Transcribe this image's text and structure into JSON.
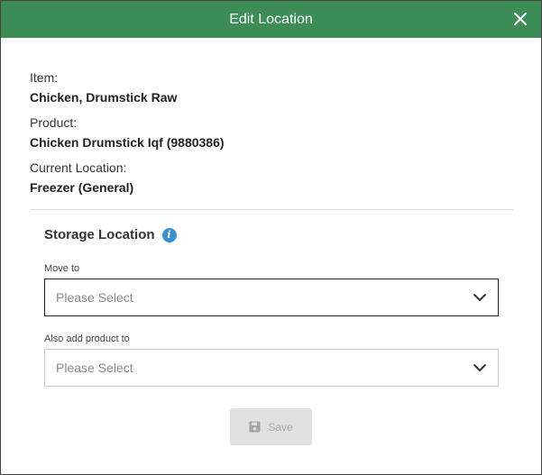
{
  "header": {
    "title": "Edit Location"
  },
  "details": {
    "item_label": "Item:",
    "item_value": "Chicken, Drumstick Raw",
    "product_label": "Product:",
    "product_value": "Chicken Drumstick Iqf (9880386)",
    "location_label": "Current Location:",
    "location_value": "Freezer (General)"
  },
  "storage": {
    "title": "Storage Location",
    "info_glyph": "i",
    "move_to_label": "Move to",
    "move_to_value": "Please Select",
    "also_add_label": "Also add product to",
    "also_add_value": "Please Select"
  },
  "actions": {
    "save_label": "Save"
  },
  "colors": {
    "header": "#3c8c55",
    "info_icon": "#3d8fd1",
    "save_disabled_bg": "#e0e0e0"
  },
  "icons": {
    "close": "close-icon",
    "info": "info-icon",
    "chevron": "chevron-down-icon",
    "save": "floppy-disk-icon"
  }
}
